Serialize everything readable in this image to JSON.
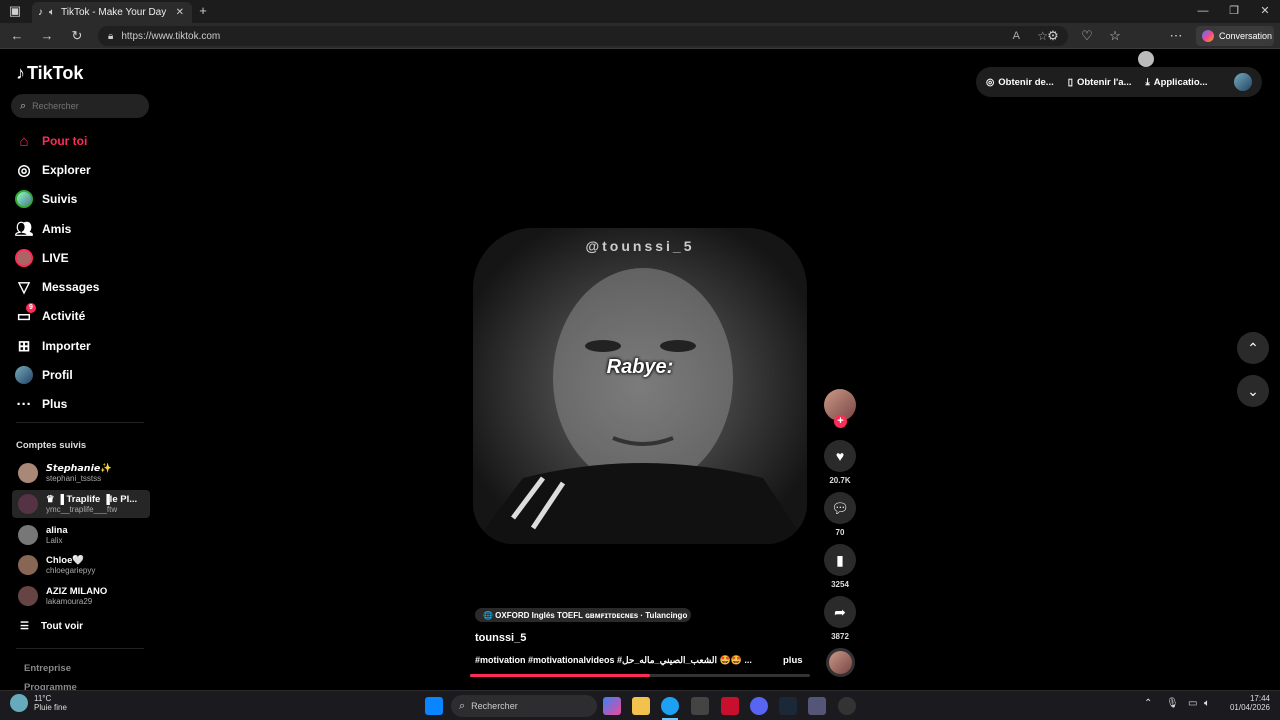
{
  "browser": {
    "tab_title": "TikTok - Make Your Day",
    "url": "https://www.tiktok.com",
    "conversation_label": "Conversation"
  },
  "tiktok": {
    "logo": "TikTok",
    "search_placeholder": "Rechercher",
    "nav": [
      {
        "label": "Pour toi",
        "icon": "home-icon",
        "active": true
      },
      {
        "label": "Explorer",
        "icon": "compass-icon"
      },
      {
        "label": "Suivis",
        "icon": "following-avatar-icon"
      },
      {
        "label": "Amis",
        "icon": "friends-icon"
      },
      {
        "label": "LIVE",
        "icon": "live-icon"
      },
      {
        "label": "Messages",
        "icon": "send-icon"
      },
      {
        "label": "Activité",
        "icon": "activity-icon",
        "badge": "9"
      },
      {
        "label": "Importer",
        "icon": "upload-icon"
      },
      {
        "label": "Profil",
        "icon": "profile-avatar-icon"
      },
      {
        "label": "Plus",
        "icon": "more-icon"
      }
    ],
    "following_title": "Comptes suivis",
    "following": [
      {
        "name": "𝙎𝙩𝙚𝙥𝙝𝙖𝙣𝙞𝙚✨",
        "handle": "stephani_tsstss"
      },
      {
        "name": "♛ ▐ Traplife ▐le Pl...",
        "handle": "ymc__traplife___ftw"
      },
      {
        "name": "alina",
        "handle": "Lalix"
      },
      {
        "name": "Chloe🤍",
        "handle": "chloegariepyy"
      },
      {
        "name": "AZIZ MILANO",
        "handle": "lakamoura29"
      }
    ],
    "see_all": "Tout voir",
    "footer_links": [
      "Entreprise",
      "Programme"
    ],
    "header_buttons": [
      "Obtenir de...",
      "Obtenir l'a...",
      "Applicatio..."
    ],
    "video": {
      "watermark": "@tounssi_5",
      "caption": "Rabye:",
      "music": "🌐 OXFORD Inglés TOEFL ɢʙᴍꜰɪᴛᴅᴇᴄɴᴇs · Tulancingo",
      "author": "tounssi_5",
      "description": "#motivation #motivationalvideos #الشعب_الصيني_ماله_حل 🤩🤩 ...",
      "more": "plus",
      "progress": 0.53
    },
    "actions": {
      "likes": "20.7K",
      "comments": "70",
      "saves": "3254",
      "shares": "3872"
    }
  },
  "taskbar": {
    "weather_temp": "11°C",
    "weather_desc": "Pluie fine",
    "search_placeholder": "Rechercher",
    "time": "17:44",
    "date": "01/04/2026"
  },
  "colors": {
    "accent": "#fe2c55",
    "bg": "#000000"
  }
}
